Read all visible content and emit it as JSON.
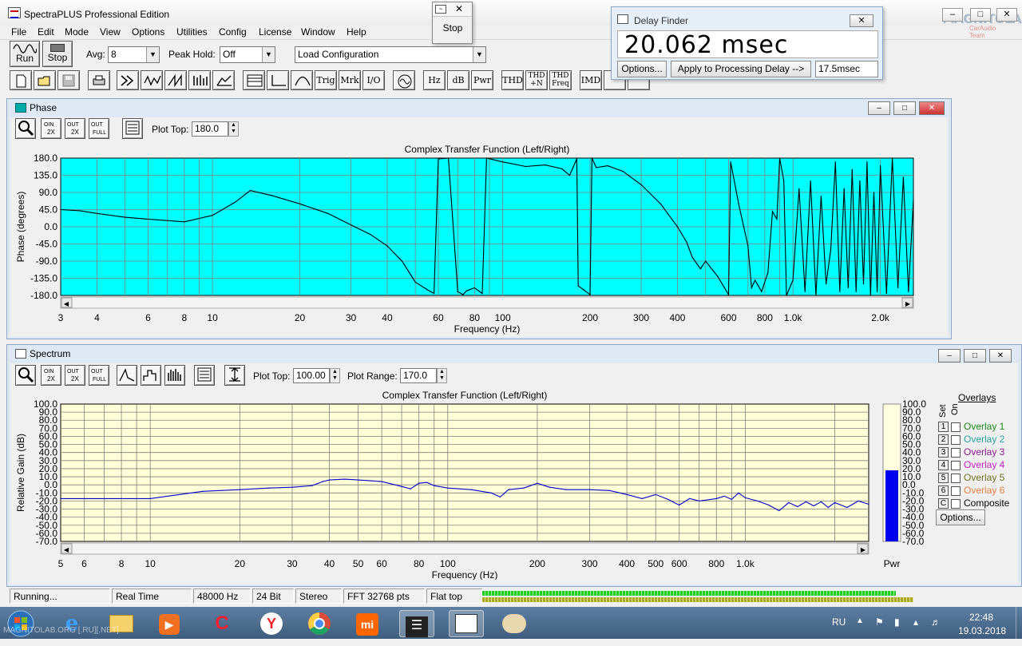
{
  "app": {
    "title": "SpectraPLUS Professional Edition"
  },
  "menu": [
    "File",
    "Edit",
    "Mode",
    "View",
    "Options",
    "Utilities",
    "Config",
    "License",
    "Window",
    "Help"
  ],
  "toolbar": {
    "run_label": "Run",
    "stop_label": "Stop",
    "avg_label": "Avg:",
    "avg_value": "8",
    "peak_hold_label": "Peak Hold:",
    "peak_hold_value": "Off",
    "load_config_value": "Load Configuration"
  },
  "toolbar2": {
    "text_buttons": [
      "Trig",
      "Mrk",
      "I/O",
      "Hz",
      "dB",
      "Pwr",
      "THD",
      "THD +N",
      "THD Freq",
      "IMD"
    ]
  },
  "stop_popup": {
    "label": "Stop"
  },
  "delay_finder": {
    "title": "Delay Finder",
    "value": "20.062 msec",
    "options_label": "Options...",
    "apply_label": "Apply to Processing Delay -->",
    "processing_delay": "17.5msec"
  },
  "watermark": {
    "brand": "MAGNITOLA",
    "sub": "CarAudio Team"
  },
  "phase_window": {
    "title": "Phase",
    "plot_top_label": "Plot Top:",
    "plot_top_value": "180.0"
  },
  "spectrum_window": {
    "title": "Spectrum",
    "plot_top_label": "Plot Top:",
    "plot_top_value": "100.00",
    "plot_range_label": "Plot Range:",
    "plot_range_value": "170.0",
    "pwr_label": "Pwr"
  },
  "overlays": {
    "title": "Overlays",
    "set_label": "Set",
    "on_label": "On",
    "items": [
      {
        "num": "1",
        "label": "Overlay 1",
        "color": "#1a8a1a"
      },
      {
        "num": "2",
        "label": "Overlay 2",
        "color": "#2aa0a0"
      },
      {
        "num": "3",
        "label": "Overlay 3",
        "color": "#8a1a8a"
      },
      {
        "num": "4",
        "label": "Overlay 4",
        "color": "#c020c0"
      },
      {
        "num": "5",
        "label": "Overlay 5",
        "color": "#707020"
      },
      {
        "num": "6",
        "label": "Overlay 6",
        "color": "#e08040"
      },
      {
        "num": "C",
        "label": "Composite",
        "color": "#000000"
      }
    ],
    "options_label": "Options..."
  },
  "status": {
    "state": "Running...",
    "mode": "Real Time",
    "rate": "48000 Hz",
    "bits": "24 Bit",
    "channels": "Stereo",
    "fft": "FFT 32768 pts",
    "window": "Flat top"
  },
  "taskbar": {
    "lang": "RU",
    "time": "22:48",
    "date": "19.03.2018",
    "watermark_text": "MAGNITOLAB.ORG [.RU][.NET]"
  },
  "chart_data": [
    {
      "type": "line",
      "title": "Complex Transfer Function (Left/Right)",
      "xlabel": "Frequency (Hz)",
      "ylabel": "Phase (degrees)",
      "x_scale": "log",
      "xlim": [
        3,
        2600
      ],
      "ylim": [
        -180,
        180
      ],
      "grid": true,
      "background": "#00ffff",
      "y_ticks": [
        "180.0",
        "135.0",
        "90.0",
        "45.0",
        "0.0",
        "-45.0",
        "-90.0",
        "-135.0",
        "-180.0"
      ],
      "x_ticks": [
        {
          "v": 3,
          "t": "3"
        },
        {
          "v": 4,
          "t": "4"
        },
        {
          "v": 6,
          "t": "6"
        },
        {
          "v": 8,
          "t": "8"
        },
        {
          "v": 10,
          "t": "10"
        },
        {
          "v": 20,
          "t": "20"
        },
        {
          "v": 30,
          "t": "30"
        },
        {
          "v": 40,
          "t": "40"
        },
        {
          "v": 60,
          "t": "60"
        },
        {
          "v": 80,
          "t": "80"
        },
        {
          "v": 100,
          "t": "100"
        },
        {
          "v": 200,
          "t": "200"
        },
        {
          "v": 300,
          "t": "300"
        },
        {
          "v": 400,
          "t": "400"
        },
        {
          "v": 600,
          "t": "600"
        },
        {
          "v": 800,
          "t": "800"
        },
        {
          "v": 1000,
          "t": "1.0k"
        },
        {
          "v": 2000,
          "t": "2.0k"
        }
      ],
      "series": [
        {
          "color": "#000000",
          "points": [
            [
              3,
              45
            ],
            [
              3.5,
              42
            ],
            [
              4,
              35
            ],
            [
              5,
              25
            ],
            [
              6,
              20
            ],
            [
              8,
              13
            ],
            [
              10,
              30
            ],
            [
              12,
              65
            ],
            [
              13.5,
              95
            ],
            [
              16,
              82
            ],
            [
              20,
              60
            ],
            [
              25,
              35
            ],
            [
              30,
              5
            ],
            [
              35,
              -20
            ],
            [
              40,
              -50
            ],
            [
              45,
              -90
            ],
            [
              50,
              -145
            ],
            [
              55,
              -165
            ],
            [
              58,
              -175
            ],
            [
              60,
              178
            ],
            [
              65,
              180
            ],
            [
              70,
              -170
            ],
            [
              73,
              -178
            ],
            [
              75,
              -168
            ],
            [
              80,
              -160
            ],
            [
              85,
              -175
            ],
            [
              88,
              180
            ],
            [
              100,
              170
            ],
            [
              120,
              158
            ],
            [
              140,
              162
            ],
            [
              160,
              152
            ],
            [
              170,
              135
            ],
            [
              180,
              178
            ],
            [
              182,
              -155
            ],
            [
              190,
              -165
            ],
            [
              200,
              -178
            ],
            [
              203,
              180
            ],
            [
              210,
              155
            ],
            [
              230,
              160
            ],
            [
              260,
              145
            ],
            [
              300,
              110
            ],
            [
              350,
              60
            ],
            [
              400,
              0
            ],
            [
              430,
              -40
            ],
            [
              450,
              -80
            ],
            [
              480,
              -110
            ],
            [
              500,
              -90
            ],
            [
              550,
              -130
            ],
            [
              600,
              -178
            ],
            [
              610,
              170
            ],
            [
              650,
              60
            ],
            [
              700,
              -50
            ],
            [
              720,
              -160
            ],
            [
              740,
              -140
            ],
            [
              780,
              -170
            ],
            [
              820,
              -120
            ],
            [
              850,
              40
            ],
            [
              880,
              20
            ],
            [
              900,
              180
            ],
            [
              930,
              120
            ],
            [
              950,
              -180
            ],
            [
              1000,
              -140
            ],
            [
              1050,
              100
            ],
            [
              1100,
              -170
            ],
            [
              1150,
              120
            ],
            [
              1200,
              -180
            ],
            [
              1250,
              80
            ],
            [
              1300,
              -150
            ],
            [
              1350,
              -60
            ],
            [
              1400,
              170
            ],
            [
              1450,
              -170
            ],
            [
              1500,
              100
            ],
            [
              1550,
              -160
            ],
            [
              1600,
              150
            ],
            [
              1650,
              -170
            ],
            [
              1700,
              120
            ],
            [
              1750,
              -150
            ],
            [
              1800,
              170
            ],
            [
              1850,
              -180
            ],
            [
              1900,
              90
            ],
            [
              1950,
              -170
            ],
            [
              2000,
              160
            ],
            [
              2100,
              -175
            ],
            [
              2200,
              180
            ],
            [
              2300,
              -160
            ],
            [
              2400,
              130
            ],
            [
              2500,
              -170
            ],
            [
              2600,
              70
            ]
          ]
        }
      ]
    },
    {
      "type": "line",
      "title": "Complex Transfer Function (Left/Right)",
      "xlabel": "Frequency (Hz)",
      "ylabel": "Relative Gain (dB)",
      "x_scale": "log",
      "xlim": [
        5,
        2600
      ],
      "ylim": [
        -70,
        100
      ],
      "grid": true,
      "background": "#ffffd8",
      "y_ticks": [
        "100.0",
        "90.0",
        "80.0",
        "70.0",
        "60.0",
        "50.0",
        "40.0",
        "30.0",
        "20.0",
        "10.0",
        "0.0",
        "-10.0",
        "-20.0",
        "-30.0",
        "-40.0",
        "-50.0",
        "-60.0",
        "-70.0"
      ],
      "x_ticks": [
        {
          "v": 5,
          "t": "5"
        },
        {
          "v": 6,
          "t": "6"
        },
        {
          "v": 8,
          "t": "8"
        },
        {
          "v": 10,
          "t": "10"
        },
        {
          "v": 20,
          "t": "20"
        },
        {
          "v": 30,
          "t": "30"
        },
        {
          "v": 40,
          "t": "40"
        },
        {
          "v": 50,
          "t": "50"
        },
        {
          "v": 60,
          "t": "60"
        },
        {
          "v": 80,
          "t": "80"
        },
        {
          "v": 100,
          "t": "100"
        },
        {
          "v": 200,
          "t": "200"
        },
        {
          "v": 300,
          "t": "300"
        },
        {
          "v": 400,
          "t": "400"
        },
        {
          "v": 500,
          "t": "500"
        },
        {
          "v": 600,
          "t": "600"
        },
        {
          "v": 800,
          "t": "800"
        },
        {
          "v": 1000,
          "t": "1.0k"
        }
      ],
      "series": [
        {
          "color": "#0000cc",
          "points": [
            [
              5,
              -17
            ],
            [
              6,
              -17
            ],
            [
              8,
              -17
            ],
            [
              10,
              -17
            ],
            [
              12,
              -13
            ],
            [
              15,
              -8
            ],
            [
              20,
              -6
            ],
            [
              25,
              -4
            ],
            [
              30,
              -3
            ],
            [
              35,
              -1
            ],
            [
              38,
              4
            ],
            [
              40,
              6
            ],
            [
              45,
              7
            ],
            [
              50,
              6
            ],
            [
              55,
              5
            ],
            [
              60,
              4
            ],
            [
              70,
              -2
            ],
            [
              75,
              -5
            ],
            [
              80,
              2
            ],
            [
              85,
              3
            ],
            [
              90,
              -1
            ],
            [
              100,
              -4
            ],
            [
              120,
              -6
            ],
            [
              140,
              -10
            ],
            [
              150,
              -15
            ],
            [
              160,
              -6
            ],
            [
              180,
              -4
            ],
            [
              200,
              2
            ],
            [
              220,
              -3
            ],
            [
              250,
              -6
            ],
            [
              300,
              -6
            ],
            [
              350,
              -7
            ],
            [
              400,
              -12
            ],
            [
              450,
              -17
            ],
            [
              500,
              -12
            ],
            [
              550,
              -18
            ],
            [
              600,
              -25
            ],
            [
              650,
              -17
            ],
            [
              700,
              -20
            ],
            [
              800,
              -17
            ],
            [
              850,
              -14
            ],
            [
              900,
              -18
            ],
            [
              950,
              -10
            ],
            [
              1000,
              -16
            ],
            [
              1100,
              -20
            ],
            [
              1200,
              -25
            ],
            [
              1300,
              -32
            ],
            [
              1400,
              -22
            ],
            [
              1500,
              -27
            ],
            [
              1600,
              -21
            ],
            [
              1700,
              -26
            ],
            [
              1800,
              -21
            ],
            [
              1900,
              -28
            ],
            [
              2000,
              -22
            ],
            [
              2200,
              -28
            ],
            [
              2400,
              -20
            ],
            [
              2600,
              -24
            ]
          ]
        }
      ],
      "pwr_meter": {
        "top": 100,
        "bottom": -70,
        "level": 18,
        "ticks": [
          "100.0",
          "90.0",
          "80.0",
          "70.0",
          "60.0",
          "50.0",
          "40.0",
          "30.0",
          "20.0",
          "10.0",
          "0.0",
          "-10.0",
          "-20.0",
          "-30.0",
          "-40.0",
          "-50.0",
          "-60.0",
          "-70.0"
        ]
      }
    }
  ]
}
